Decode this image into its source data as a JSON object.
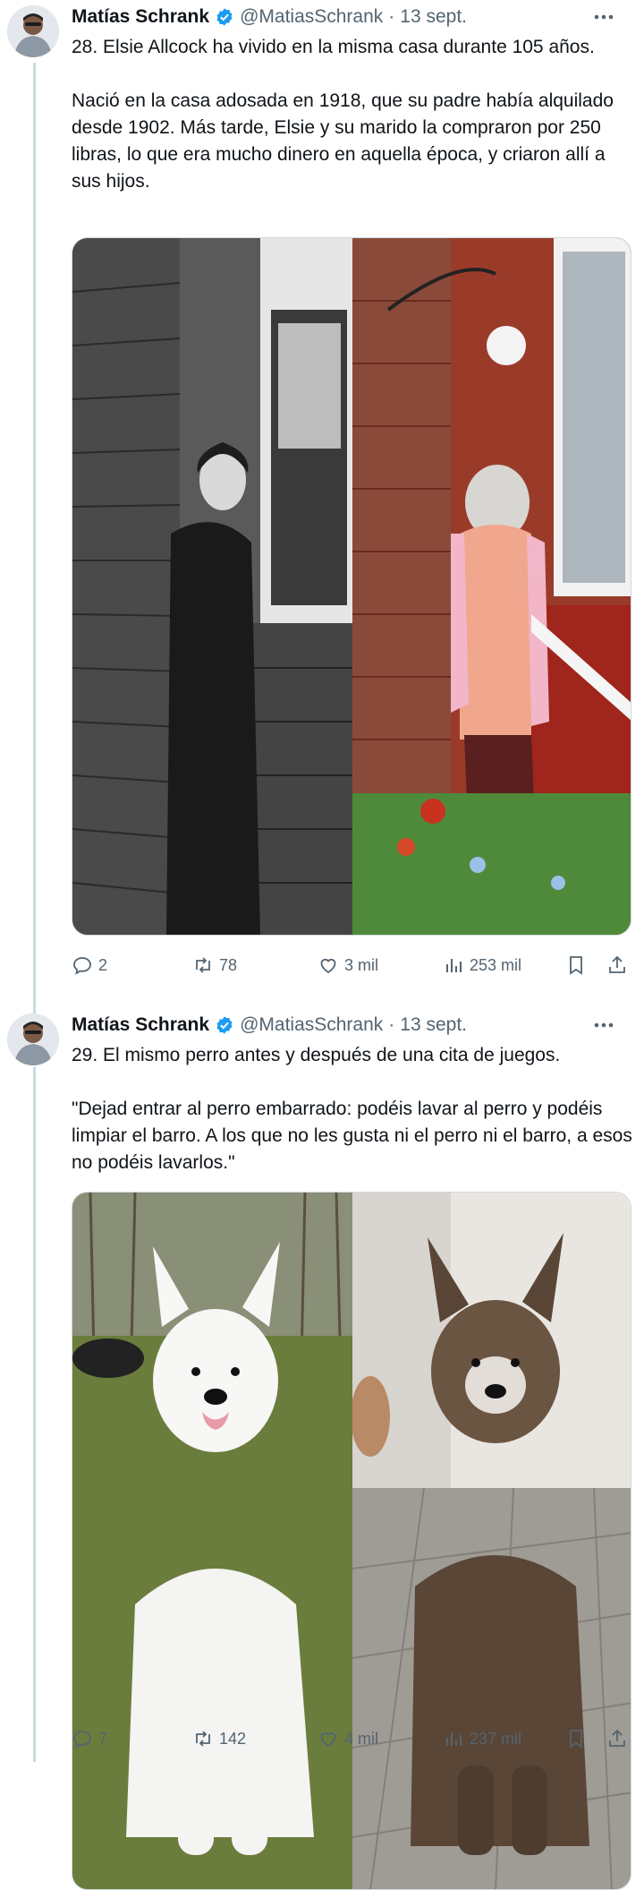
{
  "tweets": [
    {
      "author_name": "Matías Schrank",
      "handle": "@MatiasSchrank",
      "separator": "·",
      "date": "13 sept.",
      "text": "28. Elsie Allcock ha vivido en la misma casa durante 105 años.\n\nNació en la casa adosada en 1918, que su padre había alquilado desde 1902. Más tarde, Elsie y su marido la compraron por 250 libras, lo que era mucho dinero en aquella época, y criaron allí a sus hijos.",
      "stats": {
        "replies": "2",
        "retweets": "78",
        "likes": "3 mil",
        "views": "253 mil"
      }
    },
    {
      "author_name": "Matías Schrank",
      "handle": "@MatiasSchrank",
      "separator": "·",
      "date": "13 sept.",
      "text": "29. El mismo perro antes y después de una cita de juegos.\n\n\"Dejad entrar al perro embarrado: podéis lavar al perro y podéis limpiar el barro. A los que no les gusta ni el perro ni el barro, a esos no podéis lavarlos.\"",
      "stats": {
        "replies": "7",
        "retweets": "142",
        "likes": "4 mil",
        "views": "237 mil"
      }
    }
  ],
  "colors": {
    "verified": "#1d9bf0",
    "muted": "#536471",
    "divider": "#cfd9de"
  },
  "icons": [
    "verified-badge-icon",
    "more-icon",
    "reply-icon",
    "retweet-icon",
    "like-icon",
    "views-icon",
    "bookmark-icon",
    "share-icon"
  ]
}
